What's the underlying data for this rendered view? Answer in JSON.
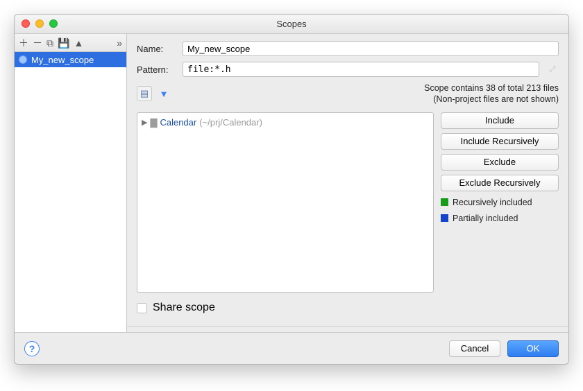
{
  "window": {
    "title": "Scopes"
  },
  "sidebar": {
    "items": [
      {
        "label": "My_new_scope"
      }
    ]
  },
  "form": {
    "name_label": "Name:",
    "name_value": "My_new_scope",
    "pattern_label": "Pattern:",
    "pattern_value": "file:*.h"
  },
  "info": {
    "line1": "Scope contains 38 of total 213 files",
    "line2": "(Non-project files are not shown)"
  },
  "tree": {
    "root": {
      "name": "Calendar",
      "path": "(~/prj/Calendar)"
    }
  },
  "buttons": {
    "include": "Include",
    "include_rec": "Include Recursively",
    "exclude": "Exclude",
    "exclude_rec": "Exclude Recursively"
  },
  "legend": {
    "rec": "Recursively included",
    "rec_color": "#1a9a1a",
    "part": "Partially included",
    "part_color": "#1644c8"
  },
  "share": {
    "label": "Share scope"
  },
  "footer": {
    "cancel": "Cancel",
    "ok": "OK"
  }
}
